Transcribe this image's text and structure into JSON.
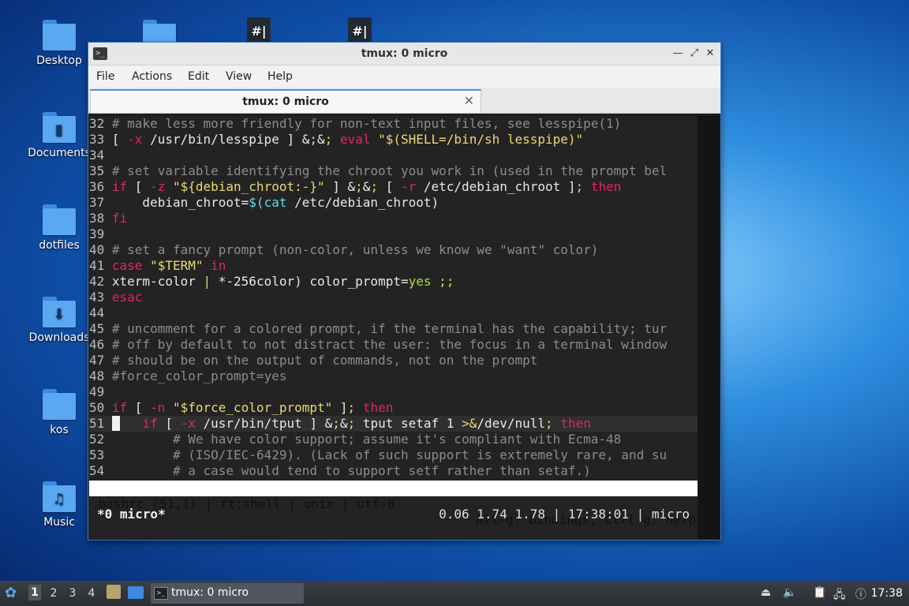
{
  "desktop": {
    "icons": [
      {
        "label": "Desktop"
      },
      {
        "label": "Documents"
      },
      {
        "label": "dotfiles"
      },
      {
        "label": "Downloads"
      },
      {
        "label": "kos"
      },
      {
        "label": "Music"
      }
    ],
    "doc_icon_glyph": "#|"
  },
  "window": {
    "title": "tmux: 0 micro",
    "menu": [
      "File",
      "Actions",
      "Edit",
      "View",
      "Help"
    ],
    "tab_label": "tmux: 0 micro"
  },
  "editor": {
    "lines": [
      {
        "n": "32",
        "t": "# make less more friendly for non-text input files, see lesspipe(1)"
      },
      {
        "n": "33",
        "t": "[ -x /usr/bin/lesspipe ] && eval \"$(SHELL=/bin/sh lesspipe)\""
      },
      {
        "n": "34",
        "t": ""
      },
      {
        "n": "35",
        "t": "# set variable identifying the chroot you work in (used in the prompt bel"
      },
      {
        "n": "36",
        "t": "if [ -z \"${debian_chroot:-}\" ] && [ -r /etc/debian_chroot ]; then"
      },
      {
        "n": "37",
        "t": "    debian_chroot=$(cat /etc/debian_chroot)"
      },
      {
        "n": "38",
        "t": "fi"
      },
      {
        "n": "39",
        "t": ""
      },
      {
        "n": "40",
        "t": "# set a fancy prompt (non-color, unless we know we \"want\" color)"
      },
      {
        "n": "41",
        "t": "case \"$TERM\" in"
      },
      {
        "n": "42",
        "t": "xterm-color | *-256color) color_prompt=yes ;;"
      },
      {
        "n": "43",
        "t": "esac"
      },
      {
        "n": "44",
        "t": ""
      },
      {
        "n": "45",
        "t": "# uncomment for a colored prompt, if the terminal has the capability; tur"
      },
      {
        "n": "46",
        "t": "# off by default to not distract the user: the focus in a terminal window"
      },
      {
        "n": "47",
        "t": "# should be on the output of commands, not on the prompt"
      },
      {
        "n": "48",
        "t": "#force_color_prompt=yes"
      },
      {
        "n": "49",
        "t": ""
      },
      {
        "n": "50",
        "t": "if [ -n \"$force_color_prompt\" ]; then"
      },
      {
        "n": "51",
        "t": "    if [ -x /usr/bin/tput ] && tput setaf 1 >&/dev/null; then"
      },
      {
        "n": "52",
        "t": "        # We have color support; assume it's compliant with Ecma-48"
      },
      {
        "n": "53",
        "t": "        # (ISO/IEC-6429). (Lack of such support is extremely rare, and su"
      },
      {
        "n": "54",
        "t": "        # a case would tend to support setf rather than setaf.)"
      }
    ],
    "status_left": ".bashrc (51,1) | ft:shell | unix | utf-8",
    "status_right": "Alt-g: bindings, Ctrl-g: help"
  },
  "tmux": {
    "left": "*0 micro*",
    "right": "0.06 1.74 1.78 | 17:38:01 | micro"
  },
  "taskbar": {
    "workspaces": [
      "1",
      "2",
      "3",
      "4"
    ],
    "task_label": "tmux: 0 micro",
    "task_icon_glyph": ">_",
    "clock": "17:38"
  }
}
